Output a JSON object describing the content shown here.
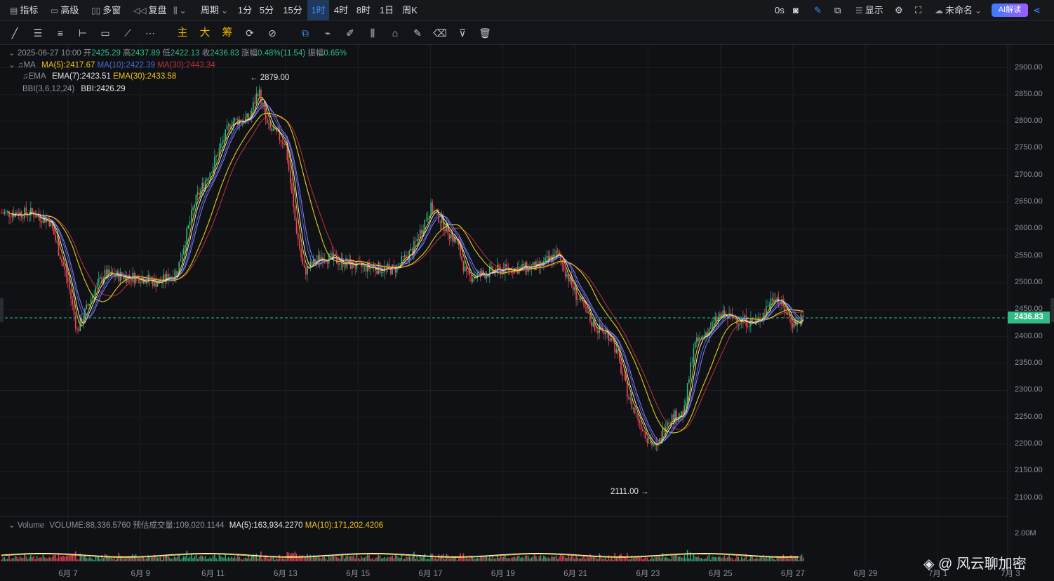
{
  "toolbar": {
    "indicators": "指标",
    "advanced": "高级",
    "multi_window": "多窗",
    "replay": "复盘",
    "period": "周期",
    "timeframes": [
      "1分",
      "5分",
      "15分",
      "1时",
      "4时",
      "8时",
      "1日",
      "周K"
    ],
    "active_timeframe": "1时",
    "latency": "0s",
    "display": "显示",
    "unnamed": "未命名",
    "ai": "AI解读"
  },
  "drawing_tools": {
    "main": "主",
    "big": "大",
    "chips": "筹"
  },
  "legend": {
    "datetime": "2025-06-27 10:00",
    "open_label": "开",
    "open": "2425.29",
    "high_label": "高",
    "high": "2437.89",
    "low_label": "低",
    "low": "2422.13",
    "close_label": "收",
    "close": "2436.83",
    "change_label": "涨幅",
    "change": "0.48%(11.54)",
    "amplitude_label": "振幅",
    "amplitude": "0.65%",
    "ma_name": "MA",
    "ma5": "MA(5):2417.67",
    "ma10": "MA(10):2422.39",
    "ma30": "MA(30):2443.34",
    "ema_name": "EMA",
    "ema7": "EMA(7):2423.51",
    "ema30": "EMA(30):2433.58",
    "bbi_name": "BBI(3,6,12,24)",
    "bbi": "BBI:2426.29"
  },
  "volume_legend": {
    "name": "Volume",
    "volume": "VOLUME:88,336.5760",
    "estimate": "预估成交量:109,020.1144",
    "ma5": "MA(5):163,934.2270",
    "ma10": "MA(10):171,202.4206",
    "axis_label": "2.00M"
  },
  "annotations": {
    "high": "← 2879.00",
    "low": "2111.00 →"
  },
  "current_price": "2436.83",
  "price_axis": [
    "2900.00",
    "2850.00",
    "2800.00",
    "2750.00",
    "2700.00",
    "2650.00",
    "2600.00",
    "2550.00",
    "2500.00",
    "2450.00",
    "2400.00",
    "2350.00",
    "2300.00",
    "2250.00",
    "2200.00",
    "2150.00",
    "2100.00"
  ],
  "date_axis": [
    "6月 7",
    "6月 9",
    "6月 11",
    "6月 13",
    "6月 15",
    "6月 17",
    "6月 19",
    "6月 21",
    "6月 23",
    "6月 25",
    "6月 27",
    "6月 29",
    "7月 1",
    "7月 3"
  ],
  "watermark": "◈ @ 风云聊加密",
  "colors": {
    "up": "#2ebd85",
    "down": "#f6465d",
    "ma5": "#f0c419",
    "ma10": "#4b6bd6",
    "ma30": "#c2313a",
    "ema7": "#ffffff",
    "ema30": "#e3d11a",
    "bbi": "#8a7dff"
  },
  "chart_data": {
    "type": "candlestick",
    "interval": "1h",
    "ylim": [
      2090,
      2920
    ],
    "x_ticks": [
      "6月 7",
      "6月 9",
      "6月 11",
      "6月 13",
      "6月 15",
      "6月 17",
      "6月 19",
      "6月 21",
      "6月 23",
      "6月 25",
      "6月 27",
      "6月 29",
      "7月 1",
      "7月 3"
    ],
    "price_path": [
      [
        "6月 6",
        2630
      ],
      [
        "6月 6 12时",
        2615
      ],
      [
        "6月 7",
        2500
      ],
      [
        "6月 7 06时",
        2410
      ],
      [
        "6月 7 18时",
        2490
      ],
      [
        "6月 8",
        2515
      ],
      [
        "6月 9",
        2510
      ],
      [
        "6月 9 12时",
        2500
      ],
      [
        "6月 10",
        2520
      ],
      [
        "6月 10 12时",
        2650
      ],
      [
        "6月 11",
        2720
      ],
      [
        "6月 11 12时",
        2800
      ],
      [
        "6月 12",
        2805
      ],
      [
        "6月 12 06时",
        2860
      ],
      [
        "6月 12 12时",
        2790
      ],
      [
        "6月 13",
        2760
      ],
      [
        "6月 13 06时",
        2620
      ],
      [
        "6月 13 12时",
        2520
      ],
      [
        "6月 14",
        2550
      ],
      [
        "6月 15",
        2530
      ],
      [
        "6月 16",
        2525
      ],
      [
        "6月 16 12时",
        2560
      ],
      [
        "6月 17",
        2640
      ],
      [
        "6月 17 06时",
        2620
      ],
      [
        "6月 17 18时",
        2570
      ],
      [
        "6月 18",
        2510
      ],
      [
        "6月 19",
        2525
      ],
      [
        "6月 20",
        2530
      ],
      [
        "6月 20 12时",
        2555
      ],
      [
        "6月 21",
        2480
      ],
      [
        "6月 21 12时",
        2420
      ],
      [
        "6月 22",
        2400
      ],
      [
        "6月 22 12时",
        2280
      ],
      [
        "6月 23",
        2210
      ],
      [
        "6月 23 06时",
        2190
      ],
      [
        "6月 23 12时",
        2245
      ],
      [
        "6月 24",
        2260
      ],
      [
        "6月 24 06时",
        2380
      ],
      [
        "6月 24 18时",
        2420
      ],
      [
        "6月 25",
        2440
      ],
      [
        "6月 26",
        2425
      ],
      [
        "6月 26 12时",
        2480
      ],
      [
        "6月 27",
        2425
      ],
      [
        "6月 27 10时",
        2436.83
      ]
    ],
    "high_marker": 2879.0,
    "low_marker": 2111.0,
    "last_close": 2436.83,
    "ma": {
      "ma5": 2417.67,
      "ma10": 2422.39,
      "ma30": 2443.34
    },
    "ema": {
      "ema7": 2423.51,
      "ema30": 2433.58
    },
    "bbi": 2426.29,
    "volume": {
      "last": 88336.576,
      "estimate": 109020.1144,
      "ma5": 163934.227,
      "ma10": 171202.4206,
      "axis_max_label": "2.00M"
    }
  }
}
